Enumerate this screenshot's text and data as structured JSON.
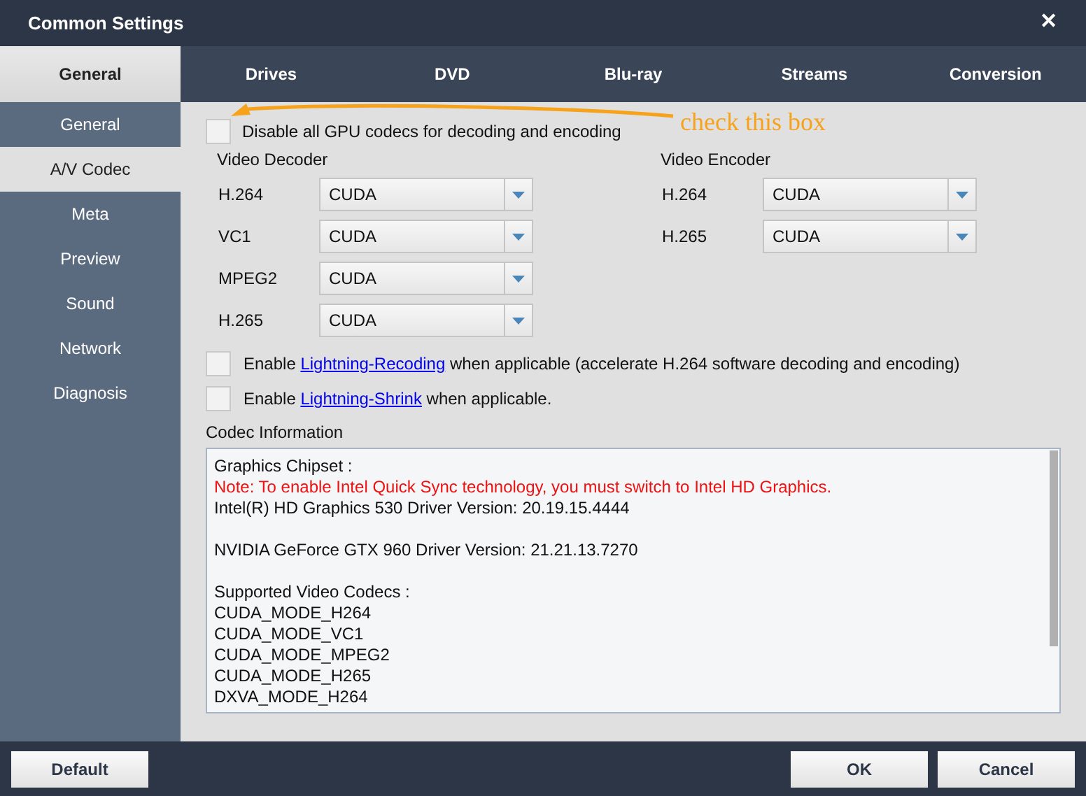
{
  "window": {
    "title": "Common Settings",
    "close": "✕"
  },
  "tabs": [
    {
      "label": "General",
      "selected": true
    },
    {
      "label": "Drives",
      "selected": false
    },
    {
      "label": "DVD",
      "selected": false
    },
    {
      "label": "Blu-ray",
      "selected": false
    },
    {
      "label": "Streams",
      "selected": false
    },
    {
      "label": "Conversion",
      "selected": false
    }
  ],
  "sidebar": {
    "items": [
      {
        "label": "General",
        "selected": false
      },
      {
        "label": "A/V Codec",
        "selected": true
      },
      {
        "label": "Meta",
        "selected": false
      },
      {
        "label": "Preview",
        "selected": false
      },
      {
        "label": "Sound",
        "selected": false
      },
      {
        "label": "Network",
        "selected": false
      },
      {
        "label": "Diagnosis",
        "selected": false
      }
    ]
  },
  "disable_gpu": {
    "label": "Disable all GPU codecs for decoding and encoding",
    "checked": false
  },
  "annotation": {
    "text": "check this box"
  },
  "video_decoder": {
    "title": "Video Decoder",
    "rows": [
      {
        "label": "H.264",
        "value": "CUDA"
      },
      {
        "label": "VC1",
        "value": "CUDA"
      },
      {
        "label": "MPEG2",
        "value": "CUDA"
      },
      {
        "label": "H.265",
        "value": "CUDA"
      }
    ]
  },
  "video_encoder": {
    "title": "Video Encoder",
    "rows": [
      {
        "label": "H.264",
        "value": "CUDA"
      },
      {
        "label": "H.265",
        "value": "CUDA"
      }
    ]
  },
  "options": [
    {
      "before": "Enable",
      "link": "Lightning-Recoding",
      "after": "when applicable (accelerate H.264 software decoding and encoding)",
      "checked": false
    },
    {
      "before": "Enable",
      "link": "Lightning-Shrink",
      "after": "when applicable.",
      "checked": false
    }
  ],
  "codec_info": {
    "title": "Codec Information",
    "lines": [
      {
        "text": "Graphics Chipset :",
        "kind": "normal"
      },
      {
        "text": "Note: To enable Intel Quick Sync technology, you must switch to Intel HD Graphics.",
        "kind": "warning"
      },
      {
        "text": "Intel(R) HD Graphics 530 Driver Version: 20.19.15.4444",
        "kind": "normal"
      },
      {
        "kind": "blank"
      },
      {
        "text": "NVIDIA GeForce GTX 960 Driver Version: 21.21.13.7270",
        "kind": "normal"
      },
      {
        "kind": "blank"
      },
      {
        "text": "Supported Video Codecs :",
        "kind": "normal"
      },
      {
        "text": "CUDA_MODE_H264",
        "kind": "normal"
      },
      {
        "text": "CUDA_MODE_VC1",
        "kind": "normal"
      },
      {
        "text": "CUDA_MODE_MPEG2",
        "kind": "normal"
      },
      {
        "text": "CUDA_MODE_H265",
        "kind": "normal"
      },
      {
        "text": "DXVA_MODE_H264",
        "kind": "normal"
      }
    ]
  },
  "buttons": {
    "default": "Default",
    "ok": "OK",
    "cancel": "Cancel"
  }
}
